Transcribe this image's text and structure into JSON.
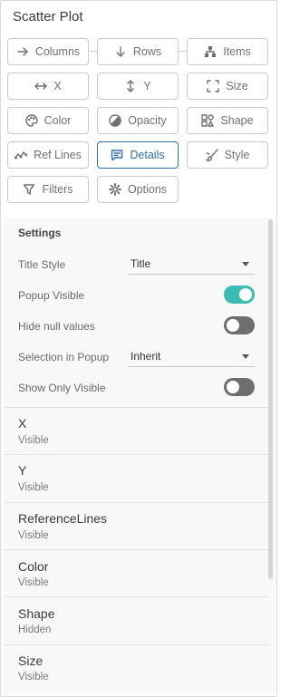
{
  "panel_title": "Scatter Plot",
  "buttons": [
    {
      "id": "columns",
      "label": "Columns",
      "icon": "arrow-right-icon"
    },
    {
      "id": "rows",
      "label": "Rows",
      "icon": "arrow-down-icon"
    },
    {
      "id": "items",
      "label": "Items",
      "icon": "hierarchy-icon"
    },
    {
      "id": "x",
      "label": "X",
      "icon": "horizontal-arrows-icon"
    },
    {
      "id": "y",
      "label": "Y",
      "icon": "vertical-arrows-icon"
    },
    {
      "id": "size",
      "label": "Size",
      "icon": "size-corners-icon"
    },
    {
      "id": "color",
      "label": "Color",
      "icon": "palette-icon"
    },
    {
      "id": "opacity",
      "label": "Opacity",
      "icon": "opacity-icon"
    },
    {
      "id": "shape",
      "label": "Shape",
      "icon": "shapes-icon"
    },
    {
      "id": "ref_lines",
      "label": "Ref Lines",
      "icon": "ref-lines-icon"
    },
    {
      "id": "details",
      "label": "Details",
      "icon": "comment-icon",
      "active": true
    },
    {
      "id": "style",
      "label": "Style",
      "icon": "brush-icon"
    },
    {
      "id": "filters",
      "label": "Filters",
      "icon": "funnel-icon"
    },
    {
      "id": "options",
      "label": "Options",
      "icon": "gear-icon"
    }
  ],
  "settings": {
    "heading": "Settings",
    "title_style": {
      "label": "Title Style",
      "value": "Title"
    },
    "popup_visible": {
      "label": "Popup Visible",
      "on": true
    },
    "hide_null": {
      "label": "Hide null values",
      "on": false
    },
    "selection_in_popup": {
      "label": "Selection in Popup",
      "value": "Inherit"
    },
    "show_only_visible": {
      "label": "Show Only Visible",
      "on": false
    }
  },
  "items": [
    {
      "name": "X",
      "status": "Visible"
    },
    {
      "name": "Y",
      "status": "Visible"
    },
    {
      "name": "ReferenceLines",
      "status": "Visible"
    },
    {
      "name": "Color",
      "status": "Visible"
    },
    {
      "name": "Shape",
      "status": "Hidden"
    },
    {
      "name": "Size",
      "status": "Visible"
    }
  ],
  "colors": {
    "accent": "#2f6fa5",
    "toggle_on": "#3bbcb3",
    "toggle_off": "#6e6e6e"
  }
}
